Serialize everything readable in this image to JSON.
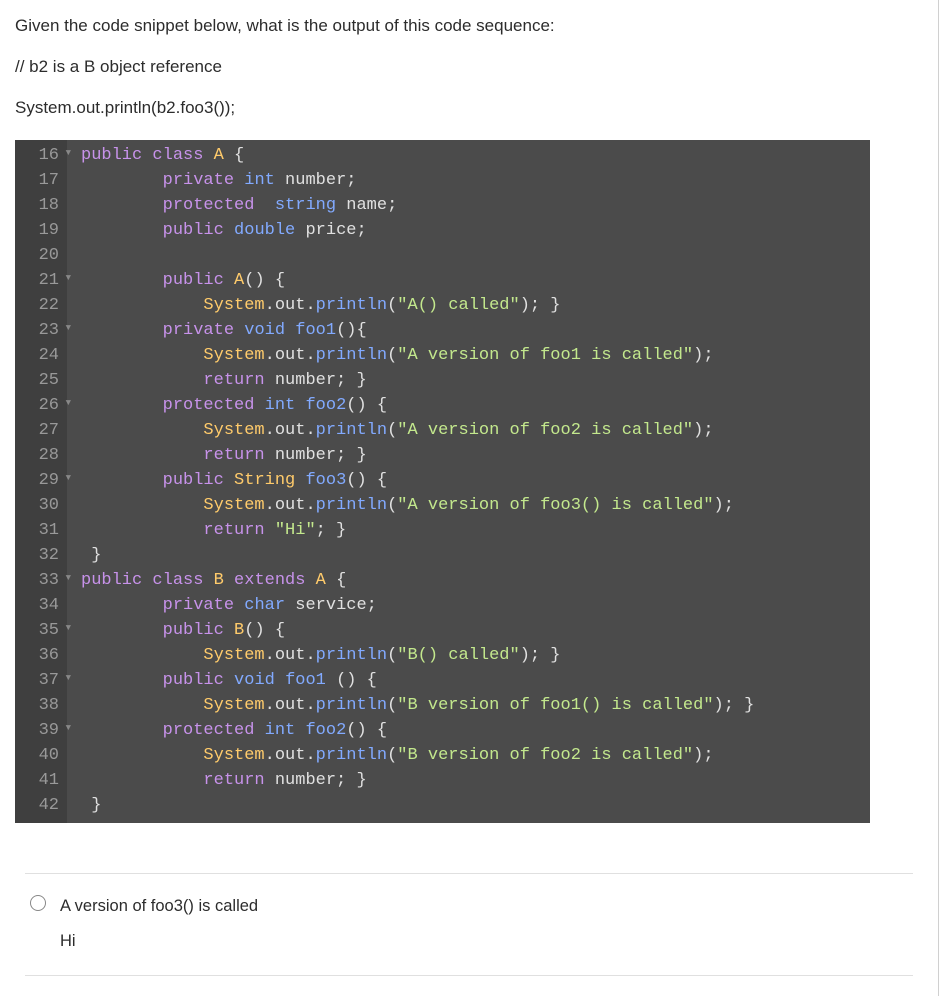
{
  "question": {
    "prompt": "Given the code snippet below, what is the output of this code sequence:",
    "comment": "// b2 is a B object reference",
    "statement": "System.out.println(b2.foo3());"
  },
  "code": {
    "lines": [
      {
        "num": "16",
        "fold": true,
        "content": [
          {
            "t": "public",
            "c": "kw"
          },
          {
            "t": " "
          },
          {
            "t": "class",
            "c": "kw"
          },
          {
            "t": " "
          },
          {
            "t": "A",
            "c": "cls"
          },
          {
            "t": " {"
          }
        ]
      },
      {
        "num": "17",
        "content": [
          {
            "t": "        "
          },
          {
            "t": "private",
            "c": "kw"
          },
          {
            "t": " "
          },
          {
            "t": "int",
            "c": "type"
          },
          {
            "t": " number;"
          }
        ]
      },
      {
        "num": "18",
        "content": [
          {
            "t": "        "
          },
          {
            "t": "protected",
            "c": "kw"
          },
          {
            "t": "  "
          },
          {
            "t": "string",
            "c": "type"
          },
          {
            "t": " name;"
          }
        ]
      },
      {
        "num": "19",
        "content": [
          {
            "t": "        "
          },
          {
            "t": "public",
            "c": "kw"
          },
          {
            "t": " "
          },
          {
            "t": "double",
            "c": "type"
          },
          {
            "t": " price;"
          }
        ]
      },
      {
        "num": "20",
        "content": []
      },
      {
        "num": "21",
        "fold": true,
        "content": [
          {
            "t": "        "
          },
          {
            "t": "public",
            "c": "kw"
          },
          {
            "t": " "
          },
          {
            "t": "A",
            "c": "cls"
          },
          {
            "t": "() {"
          }
        ]
      },
      {
        "num": "22",
        "content": [
          {
            "t": "            "
          },
          {
            "t": "System",
            "c": "cls"
          },
          {
            "t": ".out."
          },
          {
            "t": "println",
            "c": "method"
          },
          {
            "t": "("
          },
          {
            "t": "\"A() called\"",
            "c": "str"
          },
          {
            "t": "); }"
          }
        ]
      },
      {
        "num": "23",
        "fold": true,
        "content": [
          {
            "t": "        "
          },
          {
            "t": "private",
            "c": "kw"
          },
          {
            "t": " "
          },
          {
            "t": "void",
            "c": "type"
          },
          {
            "t": " "
          },
          {
            "t": "foo1",
            "c": "method"
          },
          {
            "t": "(){"
          }
        ]
      },
      {
        "num": "24",
        "content": [
          {
            "t": "            "
          },
          {
            "t": "System",
            "c": "cls"
          },
          {
            "t": ".out."
          },
          {
            "t": "println",
            "c": "method"
          },
          {
            "t": "("
          },
          {
            "t": "\"A version of foo1 is called\"",
            "c": "str"
          },
          {
            "t": ");"
          }
        ]
      },
      {
        "num": "25",
        "content": [
          {
            "t": "            "
          },
          {
            "t": "return",
            "c": "kw"
          },
          {
            "t": " number; }"
          }
        ]
      },
      {
        "num": "26",
        "fold": true,
        "content": [
          {
            "t": "        "
          },
          {
            "t": "protected",
            "c": "kw"
          },
          {
            "t": " "
          },
          {
            "t": "int",
            "c": "type"
          },
          {
            "t": " "
          },
          {
            "t": "foo2",
            "c": "method"
          },
          {
            "t": "() {"
          }
        ]
      },
      {
        "num": "27",
        "content": [
          {
            "t": "            "
          },
          {
            "t": "System",
            "c": "cls"
          },
          {
            "t": ".out."
          },
          {
            "t": "println",
            "c": "method"
          },
          {
            "t": "("
          },
          {
            "t": "\"A version of foo2 is called\"",
            "c": "str"
          },
          {
            "t": ");"
          }
        ]
      },
      {
        "num": "28",
        "content": [
          {
            "t": "            "
          },
          {
            "t": "return",
            "c": "kw"
          },
          {
            "t": " number; }"
          }
        ]
      },
      {
        "num": "29",
        "fold": true,
        "content": [
          {
            "t": "        "
          },
          {
            "t": "public",
            "c": "kw"
          },
          {
            "t": " "
          },
          {
            "t": "String",
            "c": "cls"
          },
          {
            "t": " "
          },
          {
            "t": "foo3",
            "c": "method"
          },
          {
            "t": "() {"
          }
        ]
      },
      {
        "num": "30",
        "content": [
          {
            "t": "            "
          },
          {
            "t": "System",
            "c": "cls"
          },
          {
            "t": ".out."
          },
          {
            "t": "println",
            "c": "method"
          },
          {
            "t": "("
          },
          {
            "t": "\"A version of foo3() is called\"",
            "c": "str"
          },
          {
            "t": ");"
          }
        ]
      },
      {
        "num": "31",
        "content": [
          {
            "t": "            "
          },
          {
            "t": "return",
            "c": "kw"
          },
          {
            "t": " "
          },
          {
            "t": "\"Hi\"",
            "c": "str"
          },
          {
            "t": "; }"
          }
        ]
      },
      {
        "num": "32",
        "content": [
          {
            "t": " }"
          }
        ]
      },
      {
        "num": "33",
        "fold": true,
        "content": [
          {
            "t": "public",
            "c": "kw"
          },
          {
            "t": " "
          },
          {
            "t": "class",
            "c": "kw"
          },
          {
            "t": " "
          },
          {
            "t": "B",
            "c": "cls"
          },
          {
            "t": " "
          },
          {
            "t": "extends",
            "c": "kw"
          },
          {
            "t": " "
          },
          {
            "t": "A",
            "c": "cls"
          },
          {
            "t": " {"
          }
        ]
      },
      {
        "num": "34",
        "content": [
          {
            "t": "        "
          },
          {
            "t": "private",
            "c": "kw"
          },
          {
            "t": " "
          },
          {
            "t": "char",
            "c": "type"
          },
          {
            "t": " service;"
          }
        ]
      },
      {
        "num": "35",
        "fold": true,
        "content": [
          {
            "t": "        "
          },
          {
            "t": "public",
            "c": "kw"
          },
          {
            "t": " "
          },
          {
            "t": "B",
            "c": "cls"
          },
          {
            "t": "() {"
          }
        ]
      },
      {
        "num": "36",
        "content": [
          {
            "t": "            "
          },
          {
            "t": "System",
            "c": "cls"
          },
          {
            "t": ".out."
          },
          {
            "t": "println",
            "c": "method"
          },
          {
            "t": "("
          },
          {
            "t": "\"B() called\"",
            "c": "str"
          },
          {
            "t": "); }"
          }
        ]
      },
      {
        "num": "37",
        "fold": true,
        "content": [
          {
            "t": "        "
          },
          {
            "t": "public",
            "c": "kw"
          },
          {
            "t": " "
          },
          {
            "t": "void",
            "c": "type"
          },
          {
            "t": " "
          },
          {
            "t": "foo1",
            "c": "method"
          },
          {
            "t": " () {"
          }
        ]
      },
      {
        "num": "38",
        "content": [
          {
            "t": "            "
          },
          {
            "t": "System",
            "c": "cls"
          },
          {
            "t": ".out."
          },
          {
            "t": "println",
            "c": "method"
          },
          {
            "t": "("
          },
          {
            "t": "\"B version of foo1() is called\"",
            "c": "str"
          },
          {
            "t": "); }"
          }
        ]
      },
      {
        "num": "39",
        "fold": true,
        "content": [
          {
            "t": "        "
          },
          {
            "t": "protected",
            "c": "kw"
          },
          {
            "t": " "
          },
          {
            "t": "int",
            "c": "type"
          },
          {
            "t": " "
          },
          {
            "t": "foo2",
            "c": "method"
          },
          {
            "t": "() {"
          }
        ]
      },
      {
        "num": "40",
        "content": [
          {
            "t": "            "
          },
          {
            "t": "System",
            "c": "cls"
          },
          {
            "t": ".out."
          },
          {
            "t": "println",
            "c": "method"
          },
          {
            "t": "("
          },
          {
            "t": "\"B version of foo2 is called\"",
            "c": "str"
          },
          {
            "t": ");"
          }
        ]
      },
      {
        "num": "41",
        "content": [
          {
            "t": "            "
          },
          {
            "t": "return",
            "c": "kw"
          },
          {
            "t": " number; }"
          }
        ]
      },
      {
        "num": "42",
        "content": [
          {
            "t": " }"
          }
        ]
      }
    ]
  },
  "answer": {
    "option1_line1": "A version of foo3() is called",
    "option1_line2": "Hi"
  }
}
